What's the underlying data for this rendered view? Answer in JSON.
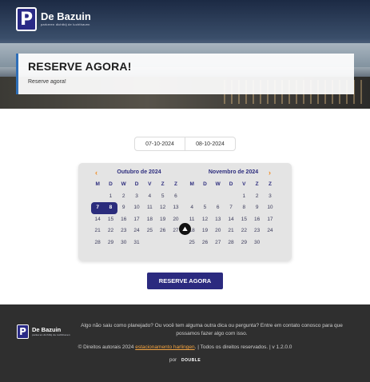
{
  "brand": {
    "name": "De Bazuin",
    "tagline": "parkeren dichtbij de luchthaven",
    "logo_letter": "P"
  },
  "hero": {
    "title": "RESERVE AGORA!",
    "subtitle": "Reserve agora!"
  },
  "dates": {
    "start": "07-10-2024",
    "end": "08-10-2024"
  },
  "calendar": {
    "weekdays": [
      "M",
      "D",
      "W",
      "D",
      "V",
      "Z",
      "Z"
    ],
    "months": [
      {
        "title": "Outubro de 2024",
        "days": [
          "",
          "1",
          "2",
          "3",
          "4",
          "5",
          "6",
          "7",
          "8",
          "9",
          "10",
          "11",
          "12",
          "13",
          "14",
          "15",
          "16",
          "17",
          "18",
          "19",
          "20",
          "21",
          "22",
          "23",
          "24",
          "25",
          "26",
          "27",
          "28",
          "29",
          "30",
          "31"
        ],
        "selected_start": "7",
        "selected_end": "8"
      },
      {
        "title": "Novembro de 2024",
        "days": [
          "",
          "",
          "",
          "",
          "1",
          "2",
          "3",
          "4",
          "5",
          "6",
          "7",
          "8",
          "9",
          "10",
          "11",
          "12",
          "13",
          "14",
          "15",
          "16",
          "17",
          "18",
          "19",
          "20",
          "21",
          "22",
          "23",
          "24",
          "25",
          "26",
          "27",
          "28",
          "29",
          "30"
        ]
      }
    ],
    "prev_icon": "chevron-left-icon",
    "next_icon": "chevron-right-icon"
  },
  "reserve_button": "RESERVE AGORA",
  "footer": {
    "message": "Algo não saiu como planejado? Ou você tem alguma outra dica ou pergunta? Entre em contato conosco para que possamos fazer algo com isso.",
    "copyright_prefix": "© Direitos autorais 2024",
    "copyright_link": "estacionamento harlingen",
    "copyright_suffix": ". | Todos os direitos reservados. | v 1.2.0.0",
    "by_label": "por",
    "by_brand": "DOUBLE"
  },
  "colors": {
    "primary": "#2b2a7f",
    "accent": "#f28a1e",
    "footer_bg": "#2f2f2f"
  }
}
